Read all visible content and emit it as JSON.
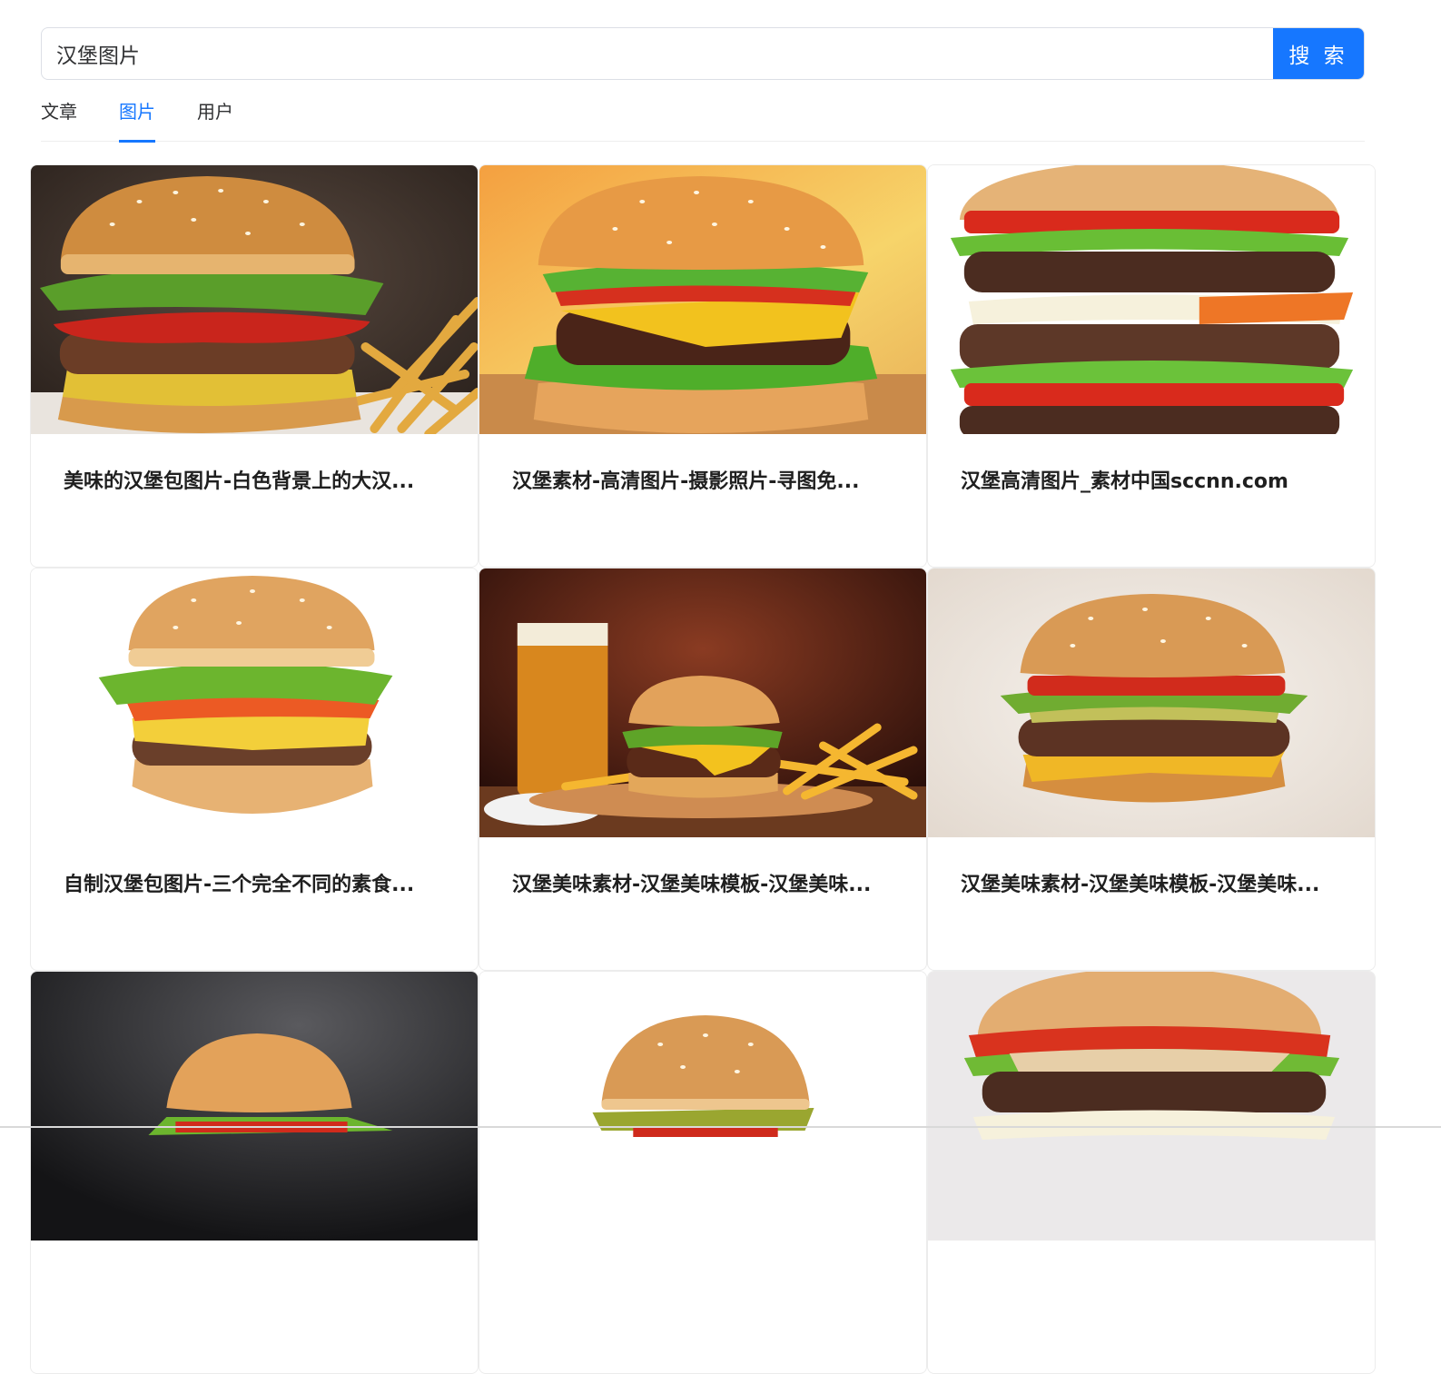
{
  "search": {
    "value": "汉堡图片",
    "button_label": "搜 索"
  },
  "tabs": [
    {
      "label": "文章",
      "active": false
    },
    {
      "label": "图片",
      "active": true
    },
    {
      "label": "用户",
      "active": false
    }
  ],
  "accent_color": "#1677ff",
  "results": [
    {
      "title": "美味的汉堡包图片-白色背景上的大汉...",
      "image": "burger-with-fries-dark-background"
    },
    {
      "title": "汉堡素材-高清图片-摄影照片-寻图免...",
      "image": "cheeseburger-warm-background"
    },
    {
      "title": "汉堡高清图片_素材中国sccnn.com",
      "image": "double-burger-white-background"
    },
    {
      "title": "自制汉堡包图片-三个完全不同的素食...",
      "image": "cheeseburger-white-background"
    },
    {
      "title": "汉堡美味素材-汉堡美味模板-汉堡美味...",
      "image": "burger-with-beer-and-fries"
    },
    {
      "title": "汉堡美味素材-汉堡美味模板-汉堡美味...",
      "image": "burger-with-cheese-beige-background"
    },
    {
      "title": "",
      "image": "burger-dark-background"
    },
    {
      "title": "",
      "image": "burger-with-pickles-white-background"
    },
    {
      "title": "",
      "image": "big-burger-grey-background"
    }
  ]
}
